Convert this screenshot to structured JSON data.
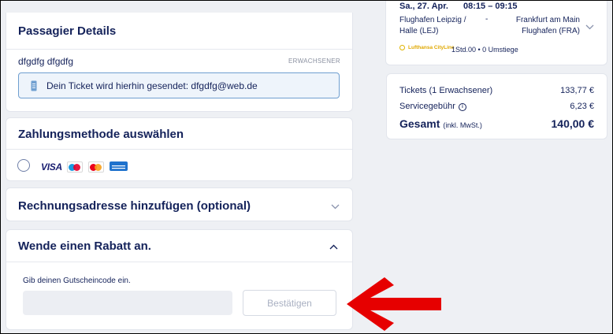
{
  "passenger": {
    "title": "Passagier Details",
    "name": "dfgdfg dfgdfg",
    "type": "ERWACHSENER",
    "ticket_notice": "Dein Ticket wird hierhin gesendet: dfgdfg@web.de"
  },
  "payment": {
    "title": "Zahlungsmethode auswählen",
    "visa_label": "VISA",
    "icons": [
      "maestro-icon",
      "mastercard-icon",
      "amex-icon"
    ]
  },
  "billing": {
    "title": "Rechnungsadresse hinzufügen (optional)"
  },
  "discount": {
    "title": "Wende einen Rabatt an.",
    "coupon_label": "Gib deinen Gutscheincode ein.",
    "coupon_value": "",
    "confirm_label": "Bestätigen"
  },
  "flight": {
    "date": "Sa., 27. Apr.",
    "times": "08:15 – 09:15",
    "from": "Flughafen Leipzig / Halle (LEJ)",
    "to": "Frankfurt am Main Flughafen (FRA)",
    "airline": "Lufthansa CityLine",
    "duration": "1Std.00 • 0 Umstiege"
  },
  "price": {
    "tickets_label": "Tickets",
    "tickets_count": "(1 Erwachsener)",
    "tickets_amount": "133,77 €",
    "service_label": "Servicegebühr",
    "service_amount": "6,23 €",
    "total_label": "Gesamt",
    "total_incl": "(inkl. MwSt.)",
    "total_amount": "140,00 €"
  },
  "colors": {
    "brand_text": "#14225a",
    "info_border": "#6f9fd0",
    "arrow": "#e60000"
  }
}
